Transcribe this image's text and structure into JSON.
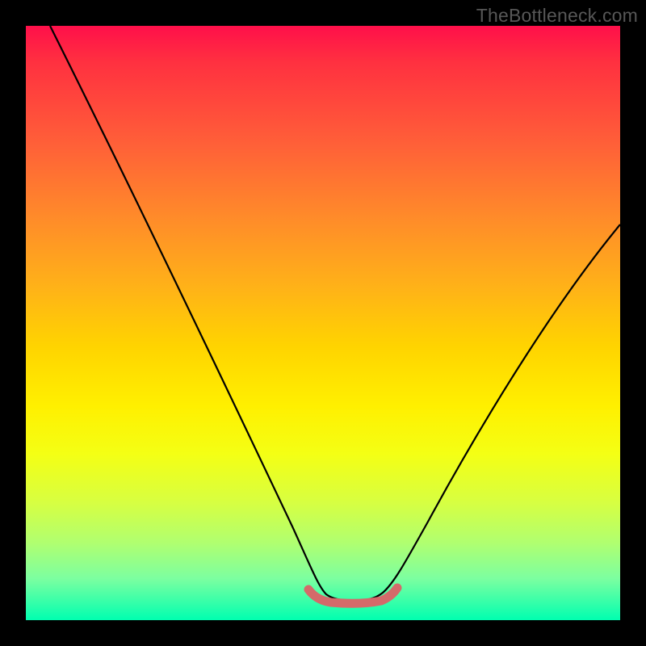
{
  "watermark": "TheBottleneck.com",
  "chart_data": {
    "type": "line",
    "title": "",
    "xlabel": "",
    "ylabel": "",
    "xlim": [
      0,
      100
    ],
    "ylim": [
      0,
      100
    ],
    "series": [
      {
        "name": "bottleneck-curve",
        "x": [
          4,
          10,
          20,
          30,
          40,
          46,
          50,
          54,
          58,
          62,
          70,
          80,
          90,
          100
        ],
        "y": [
          100,
          87,
          68,
          49,
          30,
          14,
          6,
          3,
          3,
          6,
          19,
          38,
          55,
          67
        ]
      }
    ],
    "marker_band": {
      "name": "optimal-range",
      "x_start": 48,
      "x_end": 62,
      "y": 4,
      "color": "#d46a6a"
    },
    "gradient_stops": [
      {
        "pos": 0,
        "color": "#ff0f4a"
      },
      {
        "pos": 20,
        "color": "#ff6038"
      },
      {
        "pos": 44,
        "color": "#ffb218"
      },
      {
        "pos": 64,
        "color": "#fff000"
      },
      {
        "pos": 87,
        "color": "#b0ff70"
      },
      {
        "pos": 100,
        "color": "#00ffb0"
      }
    ]
  }
}
